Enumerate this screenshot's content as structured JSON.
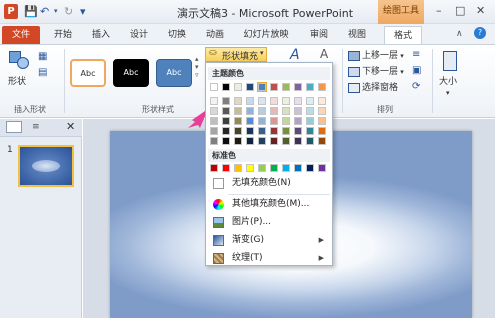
{
  "title_bar": {
    "app_icon_letter": "P",
    "title": "演示文稿3 - Microsoft PowerPoint",
    "context_tools": "绘图工具",
    "window_controls": [
      "–",
      "□",
      "✕"
    ]
  },
  "tabs": [
    {
      "label": "文件"
    },
    {
      "label": "开始"
    },
    {
      "label": "插入"
    },
    {
      "label": "设计"
    },
    {
      "label": "切换"
    },
    {
      "label": "动画"
    },
    {
      "label": "幻灯片放映"
    },
    {
      "label": "审阅"
    },
    {
      "label": "视图"
    },
    {
      "label": "格式"
    }
  ],
  "ribbon": {
    "insert_shape": {
      "shape_button": "形状",
      "group_label": "插入形状"
    },
    "shape_styles": {
      "style_samples": [
        "Abc",
        "Abc",
        "Abc"
      ],
      "group_label": "形状样式",
      "fill_button": "形状填充"
    },
    "arrange": {
      "bring_forward": "上移一层",
      "send_backward": "下移一层",
      "selection_pane": "选择窗格",
      "group_label": "排列"
    },
    "size": {
      "label": "大小"
    }
  },
  "slides_pane": {
    "slide_number": "1"
  },
  "fill_menu": {
    "theme_colors_header": "主题颜色",
    "standard_colors_header": "标准色",
    "theme_colors": [
      [
        "#ffffff",
        "#000000",
        "#eeece1",
        "#1f497d",
        "#4f81bd",
        "#c0504d",
        "#9bbb59",
        "#8064a2",
        "#4bacc6",
        "#f79646"
      ],
      [
        "#f2f2f2",
        "#7f7f7f",
        "#ddd9c3",
        "#c6d9f0",
        "#dbe5f1",
        "#f2dcdb",
        "#ebf1dd",
        "#e5e0ec",
        "#dbeef3",
        "#fdeada"
      ],
      [
        "#d8d8d8",
        "#595959",
        "#c4bd97",
        "#8db3e2",
        "#b8cce4",
        "#e5b9b7",
        "#d7e3bc",
        "#ccc1d9",
        "#b7dde8",
        "#fbd5b5"
      ],
      [
        "#bfbfbf",
        "#3f3f3f",
        "#938953",
        "#548dd4",
        "#95b3d7",
        "#d99694",
        "#c3d69b",
        "#b2a2c7",
        "#92cddc",
        "#fac08f"
      ],
      [
        "#a5a5a5",
        "#262626",
        "#494429",
        "#17365d",
        "#366092",
        "#953734",
        "#76923c",
        "#5f497a",
        "#31859b",
        "#e36c09"
      ],
      [
        "#7f7f7f",
        "#0c0c0c",
        "#1d1b10",
        "#0f243e",
        "#244061",
        "#632423",
        "#4f6128",
        "#3f3151",
        "#205867",
        "#974806"
      ]
    ],
    "standard_colors": [
      "#c00000",
      "#ff0000",
      "#ffc000",
      "#ffff00",
      "#92d050",
      "#00b050",
      "#00b0f0",
      "#0070c0",
      "#002060",
      "#7030a0"
    ],
    "items": [
      {
        "label": "无填充颜色(N)"
      },
      {
        "label": "其他填充颜色(M)..."
      },
      {
        "label": "图片(P)..."
      },
      {
        "label": "渐变(G)"
      },
      {
        "label": "纹理(T)"
      }
    ]
  }
}
